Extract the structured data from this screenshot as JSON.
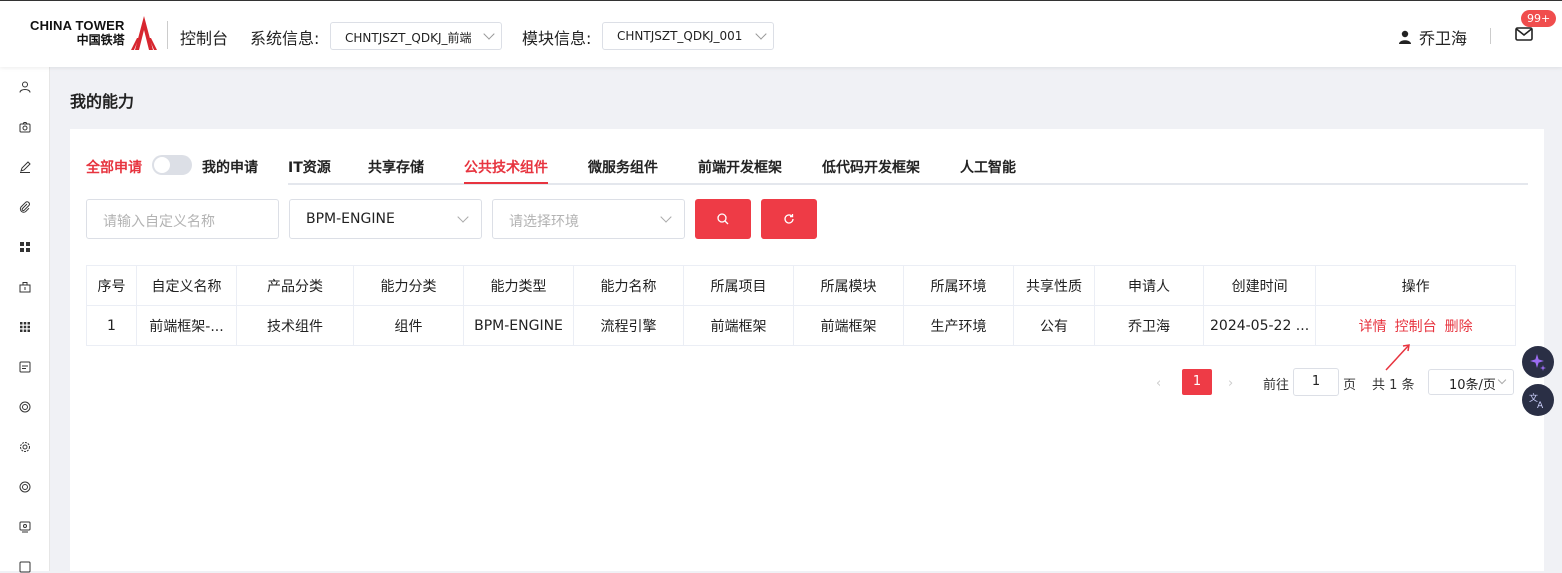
{
  "header": {
    "logo_en": "CHINA TOWER",
    "logo_cn": "中国铁塔",
    "console_title": "控制台",
    "system_label": "系统信息:",
    "system_value": "CHNTJSZT_QDKJ_前端",
    "module_label": "模块信息:",
    "module_value": "CHNTJSZT_QDKJ_001",
    "user_name": "乔卫海",
    "badge": "99+",
    "user_icon": "user-icon",
    "mail_icon": "mail-icon"
  },
  "sidebar": {
    "icons": [
      "user-icon",
      "camera-icon",
      "pen-icon",
      "paperclip-icon",
      "grid-icon",
      "package-icon",
      "apps-icon",
      "image-icon",
      "ring-icon",
      "gear-icon",
      "ring-icon",
      "monitor-icon",
      "window-icon"
    ]
  },
  "page_title": "我的能力",
  "filters": {
    "all_label": "全部申请",
    "mine_label": "我的申请",
    "toggle_on": false
  },
  "tabs": [
    {
      "label": "IT资源",
      "active": false
    },
    {
      "label": "共享存储",
      "active": false
    },
    {
      "label": "公共技术组件",
      "active": true
    },
    {
      "label": "微服务组件",
      "active": false
    },
    {
      "label": "前端开发框架",
      "active": false
    },
    {
      "label": "低代码开发框架",
      "active": false
    },
    {
      "label": "人工智能",
      "active": false
    }
  ],
  "search": {
    "name_placeholder": "请输入自定义名称",
    "product_value": "BPM-ENGINE",
    "env_placeholder": "请选择环境",
    "search_icon": "search-icon",
    "refresh_icon": "refresh-icon"
  },
  "table": {
    "columns": [
      "序号",
      "自定义名称",
      "产品分类",
      "能力分类",
      "能力类型",
      "能力名称",
      "所属项目",
      "所属模块",
      "所属环境",
      "共享性质",
      "申请人",
      "创建时间",
      "操作"
    ],
    "rows": [
      {
        "cells": [
          "1",
          "前端框架-...",
          "技术组件",
          "组件",
          "BPM-ENGINE",
          "流程引擎",
          "前端框架",
          "前端框架",
          "生产环境",
          "公有",
          "乔卫海",
          "2024-05-22 ..."
        ],
        "actions": [
          "详情",
          "控制台",
          "删除"
        ]
      }
    ]
  },
  "pagination": {
    "current_page": "1",
    "goto_label": "前往",
    "goto_value": "1",
    "page_unit": "页",
    "total": "共 1 条",
    "page_size": "10条/页"
  },
  "colors": {
    "accent": "#e7343f",
    "button": "#ee3b46"
  }
}
